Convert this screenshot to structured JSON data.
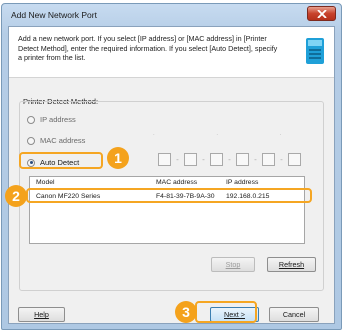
{
  "window": {
    "title": "Add New Network Port",
    "close_icon": "close-icon"
  },
  "header": {
    "description": "Add a new network port. If you select [IP address] or [MAC address] in [Printer Detect Method], enter the required information. If you select [Auto Detect], specify a printer from the list.",
    "icon": "network-wizard-icon"
  },
  "detect_method": {
    "label": "Printer Detect Method:",
    "options": [
      {
        "label": "IP address",
        "selected": false
      },
      {
        "label": "MAC address",
        "selected": false
      },
      {
        "label": "Auto Detect",
        "selected": true
      }
    ],
    "ip_placeholder": ". . .",
    "mac_separators": [
      "-",
      "-",
      "-",
      "-",
      "-"
    ]
  },
  "printer_list": {
    "columns": [
      "Model",
      "MAC address",
      "IP address"
    ],
    "rows": [
      {
        "model": "Canon MF220 Series",
        "mac": "F4-81-39-7B-9A-30",
        "ip": "192.168.0.215"
      }
    ]
  },
  "buttons": {
    "stop": "Stop",
    "refresh": "Refresh",
    "help": "Help",
    "next": "Next >",
    "cancel": "Cancel"
  },
  "callouts": [
    "1",
    "2",
    "3"
  ],
  "colors": {
    "highlight": "#f5a623",
    "badge": "#f4a21c",
    "titlebar": "#c7dbf0",
    "close": "#c8432c"
  }
}
